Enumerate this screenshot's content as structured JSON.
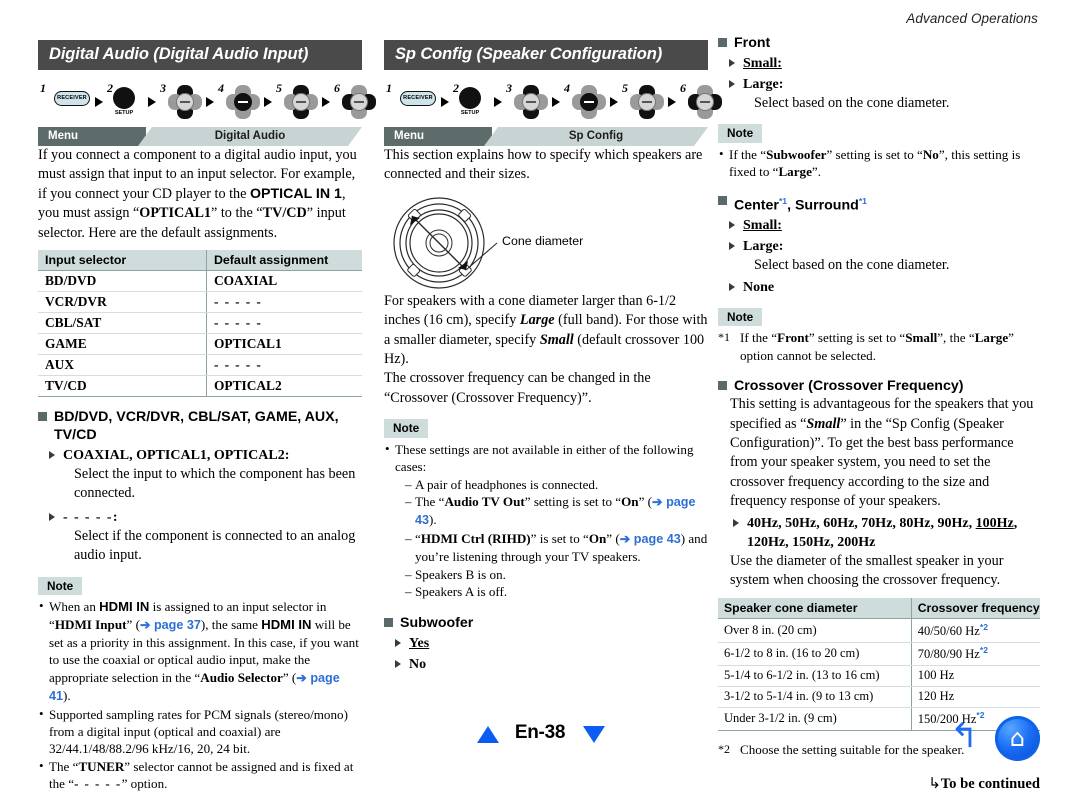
{
  "running_head": "Advanced Operations",
  "page_number": "En-38",
  "col1": {
    "title": "Digital Audio (Digital Audio Input)",
    "keyseq": {
      "steps": [
        "1",
        "2",
        "3",
        "4",
        "5",
        "6"
      ],
      "receiver_label": "RECEIVER",
      "setup_label": "SETUP"
    },
    "menubar": {
      "left": "Menu",
      "right": "Digital Audio"
    },
    "intro": {
      "p1_a": "If you connect a component to a digital audio input, you must assign that input to an input selector. For example, if you connect your CD player to the ",
      "p1_b": "OPTICAL IN 1",
      "p1_c": ", you must assign “",
      "p1_d": "OPTICAL1",
      "p1_e": "” to the “",
      "p1_f": "TV/CD",
      "p1_g": "” input selector. Here are the default assignments."
    },
    "table": {
      "headers": [
        "Input selector",
        "Default assignment"
      ],
      "rows": [
        [
          "BD/DVD",
          "COAXIAL"
        ],
        [
          "VCR/DVR",
          "- - - - -"
        ],
        [
          "CBL/SAT",
          "- - - - -"
        ],
        [
          "GAME",
          "OPTICAL1"
        ],
        [
          "AUX",
          "- - - - -"
        ],
        [
          "TV/CD",
          "OPTICAL2"
        ]
      ]
    },
    "heading": "BD/DVD, VCR/DVR, CBL/SAT, GAME, AUX, TV/CD",
    "option1_label": "COAXIAL, OPTICAL1, OPTICAL2:",
    "option1_desc": "Select the input to which the component has been connected.",
    "option2_label": "- - - - -:",
    "option2_desc": "Select if the component is connected to an analog audio input.",
    "note_tag": "Note",
    "note1": {
      "a": "When an ",
      "b": "HDMI IN",
      "c": " is assigned to an input selector in “",
      "d": "HDMI Input",
      "e": "” (",
      "link1": "➔ page 37",
      "f": "), the same ",
      "g": "HDMI IN",
      "h": " will be set as a priority in this assignment. In this case, if you want to use the coaxial or optical audio input, make the appropriate selection in the “",
      "i": "Audio Selector",
      "j": "” (",
      "link2": "➔ page 41",
      "k": ")."
    },
    "note2": "Supported sampling rates for PCM signals (stereo/mono) from a digital input (optical and coaxial) are 32/44.1/48/88.2/96 kHz/16, 20, 24 bit.",
    "note3": {
      "a": "The “",
      "b": "TUNER",
      "c": "” selector cannot be assigned and is fixed at the “",
      "d": "- - - - -",
      "e": "” option."
    }
  },
  "col2": {
    "title": "Sp Config (Speaker Configuration)",
    "keyseq": {
      "steps": [
        "1",
        "2",
        "3",
        "4",
        "5",
        "6"
      ],
      "receiver_label": "RECEIVER",
      "setup_label": "SETUP"
    },
    "menubar": {
      "left": "Menu",
      "right": "Sp Config"
    },
    "intro": "This section explains how to specify which speakers are connected and their sizes.",
    "figure_label": "Cone diameter",
    "para2": {
      "a": "For speakers with a cone diameter larger than 6-1/2 inches (16 cm), specify ",
      "b": "Large",
      "c": " (full band). For those with a smaller diameter, specify ",
      "d": "Small",
      "e": " (default crossover 100 Hz)."
    },
    "para3": "The crossover frequency can be changed in the “Crossover (Crossover Frequency)”.",
    "note_tag": "Note",
    "note_lead": "These settings are not available in either of the following cases:",
    "note_subitems": [
      {
        "text": "A pair of headphones is connected."
      },
      {
        "a": "The “",
        "b": "Audio TV Out",
        "c": "” setting is set to “",
        "d": "On",
        "e": "” (",
        "link": "➔ page 43",
        "f": ")."
      },
      {
        "a": "“",
        "b": "HDMI Ctrl (RIHD)",
        "c": "” is set to “",
        "d": "On",
        "e": "” (",
        "link": "➔ page 43",
        "f": ") and you’re listening through your TV speakers."
      },
      {
        "text": "Speakers B is on."
      },
      {
        "text": "Speakers A is off."
      }
    ],
    "subwoofer_heading": "Subwoofer",
    "subwoofer_options": [
      "Yes",
      "No"
    ]
  },
  "col3": {
    "front_heading": "Front",
    "front_options": [
      "Small:",
      "Large:"
    ],
    "front_desc": "Select based on the cone diameter.",
    "note_tag_1": "Note",
    "note1": {
      "a": "If the “",
      "b": "Subwoofer",
      "c": "” setting is set to “",
      "d": "No",
      "e": "”, this setting is fixed to “",
      "f": "Large",
      "g": "”."
    },
    "center_heading_a": "Center",
    "center_heading_sup1": "*1",
    "center_heading_b": ", Surround",
    "center_heading_sup2": "*1",
    "center_options": [
      "Small:",
      "Large:",
      "None"
    ],
    "center_desc": "Select based on the cone diameter.",
    "note_tag_2": "Note",
    "footnote1": {
      "mark": "*1",
      "a": "If the “",
      "b": "Front",
      "c": "” setting is set to “",
      "d": "Small",
      "e": "”, the “",
      "f": "Large",
      "g": "” option cannot be selected."
    },
    "crossover_heading": "Crossover (Crossover Frequency)",
    "crossover_para": {
      "a": "This setting is advantageous for the speakers that you specified as “",
      "b": "Small",
      "c": "” in the “Sp Config (Speaker Configuration)”. To get the best bass performance from your speaker system, you need to set the crossover frequency according to the size and frequency response of your speakers."
    },
    "crossover_values_line1": "40Hz, 50Hz, 60Hz, 70Hz, 80Hz, 90Hz, ",
    "crossover_values_default": "100Hz",
    "crossover_values_line1_end": ",",
    "crossover_values_line2": "120Hz, 150Hz, 200Hz",
    "crossover_after": "Use the diameter of the smallest speaker in your system when choosing the crossover frequency.",
    "table": {
      "headers": [
        "Speaker cone diameter",
        "Crossover frequency"
      ],
      "rows": [
        [
          "Over 8 in. (20 cm)",
          "40/50/60 Hz",
          "*2"
        ],
        [
          "6-1/2 to 8 in. (16 to 20 cm)",
          "70/80/90 Hz",
          "*2"
        ],
        [
          "5-1/4 to 6-1/2 in. (13 to 16 cm)",
          "100 Hz",
          ""
        ],
        [
          "3-1/2 to 5-1/4 in. (9 to 13 cm)",
          "120 Hz",
          ""
        ],
        [
          "Under 3-1/2 in. (9 cm)",
          "150/200 Hz",
          "*2"
        ]
      ]
    },
    "footnote2": {
      "mark": "*2",
      "text": "Choose the setting suitable for the speaker."
    },
    "to_be_continued": "To be continued"
  },
  "footer": {
    "page_label": "En-38",
    "prev_icon": "triangle-up-icon",
    "next_icon": "triangle-down-icon",
    "back_icon": "back-arrow-icon",
    "home_icon": "home-icon"
  }
}
